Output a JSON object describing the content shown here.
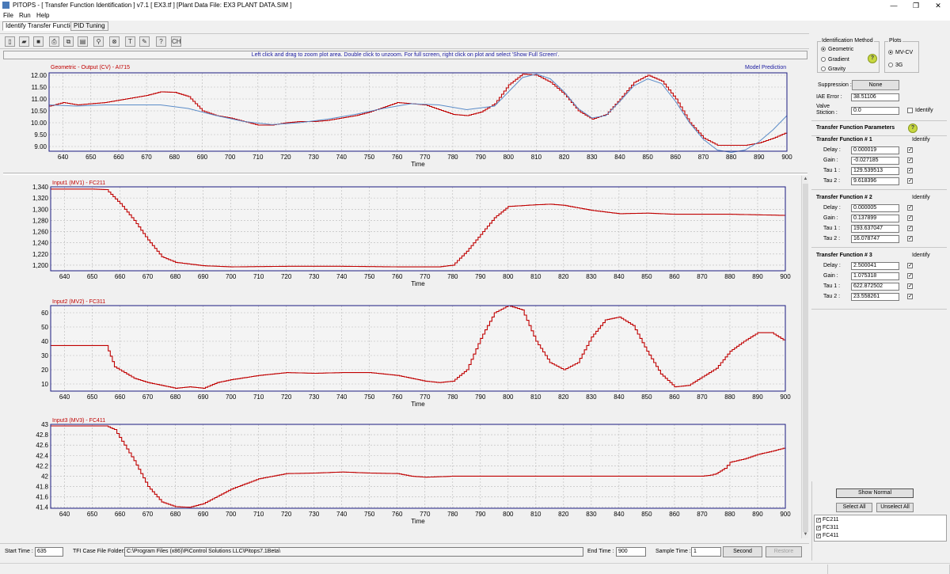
{
  "window": {
    "title": "PITOPS - [ Transfer Function Identification ] v7.1   [ EX3.tf ] [Plant Data File: EX3 PLANT DATA.SIM ]",
    "minimize": "—",
    "restore": "❐",
    "close": "✕"
  },
  "menu": [
    "File",
    "Run",
    "Help"
  ],
  "tabs": [
    "Identify Transfer Functions",
    "PID Tuning"
  ],
  "toolbar": {
    "icons": [
      "new-file-icon",
      "open-folder-icon",
      "save-icon",
      "print-icon",
      "copy-icon",
      "chart-icon",
      "zoom-icon",
      "stop-icon",
      "text-icon",
      "pen-icon",
      "help-icon",
      "ch-icon"
    ],
    "glyphs": [
      "▯",
      "▰",
      "■",
      "⎙",
      "⧉",
      "▤",
      "⚲",
      "⊗",
      "T",
      "✎",
      "?",
      "CH"
    ]
  },
  "hint": "Left click and drag to zoom plot area. Double click to unzoom. For full screen, right click on plot and select 'Show Full Screen'.",
  "charts": [
    {
      "id": "output",
      "title": "Geometric - Output (CV) - AI715",
      "legend_right": "Model Prediction",
      "xlabel": "Time",
      "xticks": [
        640,
        650,
        660,
        670,
        680,
        690,
        700,
        710,
        720,
        730,
        740,
        750,
        760,
        770,
        780,
        790,
        800,
        810,
        820,
        830,
        840,
        850,
        860,
        870,
        880,
        890,
        900
      ],
      "yticks": [
        "12.00",
        "11.50",
        "11.00",
        "10.50",
        "10.00",
        "9.50",
        "9.00"
      ]
    },
    {
      "id": "mv1",
      "title": "Input1 (MV1) - FC211",
      "xlabel": "Time",
      "xticks": [
        640,
        650,
        660,
        670,
        680,
        690,
        700,
        710,
        720,
        730,
        740,
        750,
        760,
        770,
        780,
        790,
        800,
        810,
        820,
        830,
        840,
        850,
        860,
        870,
        880,
        890,
        900
      ],
      "yticks": [
        "1,340",
        "1,320",
        "1,300",
        "1,280",
        "1,260",
        "1,240",
        "1,220",
        "1,200"
      ]
    },
    {
      "id": "mv2",
      "title": "Input2 (MV2) - FC311",
      "xlabel": "Time",
      "xticks": [
        640,
        650,
        660,
        670,
        680,
        690,
        700,
        710,
        720,
        730,
        740,
        750,
        760,
        770,
        780,
        790,
        800,
        810,
        820,
        830,
        840,
        850,
        860,
        870,
        880,
        890,
        900
      ],
      "yticks": [
        "60",
        "50",
        "40",
        "30",
        "20",
        "10"
      ]
    },
    {
      "id": "mv3",
      "title": "Input3 (MV3) - FC411",
      "xlabel": "Time",
      "xticks": [
        640,
        650,
        660,
        670,
        680,
        690,
        700,
        710,
        720,
        730,
        740,
        750,
        760,
        770,
        780,
        790,
        800,
        810,
        820,
        830,
        840,
        850,
        860,
        870,
        880,
        890,
        900
      ],
      "yticks": [
        "43",
        "42.8",
        "42.6",
        "42.4",
        "42.2",
        "42",
        "41.8",
        "41.6",
        "41.4"
      ]
    }
  ],
  "chart_data": [
    {
      "type": "line",
      "title": "Geometric - Output (CV) - AI715",
      "xlabel": "Time",
      "xlim": [
        635,
        900
      ],
      "ylim": [
        8.8,
        12.1
      ],
      "grid": true,
      "series": [
        {
          "name": "",
          "color": "#c00000",
          "x": [
            635,
            640,
            645,
            650,
            655,
            660,
            665,
            670,
            675,
            680,
            685,
            690,
            695,
            700,
            705,
            710,
            715,
            720,
            725,
            730,
            735,
            740,
            745,
            750,
            755,
            760,
            765,
            770,
            775,
            780,
            785,
            790,
            795,
            800,
            805,
            810,
            815,
            820,
            825,
            830,
            835,
            840,
            845,
            850,
            855,
            860,
            865,
            870,
            875,
            880,
            885,
            890,
            895,
            900
          ],
          "y": [
            10.7,
            10.85,
            10.75,
            10.8,
            10.85,
            10.95,
            11.05,
            11.15,
            11.3,
            11.28,
            11.1,
            10.5,
            10.3,
            10.2,
            10.05,
            9.9,
            9.9,
            10.0,
            10.05,
            10.05,
            10.1,
            10.2,
            10.3,
            10.45,
            10.65,
            10.85,
            10.8,
            10.75,
            10.55,
            10.35,
            10.3,
            10.45,
            10.8,
            11.6,
            12.05,
            12.0,
            11.7,
            11.2,
            10.5,
            10.15,
            10.35,
            11.0,
            11.7,
            12.0,
            11.75,
            11.0,
            10.0,
            9.35,
            9.05,
            9.05,
            9.05,
            9.15,
            9.35,
            9.6
          ]
        },
        {
          "name": "Model Prediction",
          "color": "#5b8cc8",
          "x": [
            635,
            645,
            655,
            665,
            675,
            685,
            695,
            705,
            715,
            725,
            735,
            745,
            755,
            765,
            775,
            785,
            795,
            800,
            805,
            810,
            815,
            820,
            825,
            830,
            835,
            840,
            845,
            850,
            855,
            860,
            865,
            870,
            875,
            880,
            885,
            890,
            895,
            900
          ],
          "y": [
            10.75,
            10.7,
            10.75,
            10.75,
            10.75,
            10.6,
            10.3,
            10.05,
            9.92,
            10.0,
            10.15,
            10.35,
            10.6,
            10.8,
            10.75,
            10.55,
            10.7,
            11.3,
            11.9,
            12.05,
            11.85,
            11.3,
            10.6,
            10.2,
            10.3,
            10.9,
            11.55,
            11.85,
            11.65,
            10.9,
            10.0,
            9.3,
            8.85,
            8.75,
            8.85,
            9.2,
            9.7,
            10.3
          ]
        }
      ]
    },
    {
      "type": "line",
      "title": "Input1 (MV1) - FC211",
      "xlabel": "Time",
      "xlim": [
        635,
        900
      ],
      "ylim": [
        1190,
        1340
      ],
      "grid": true,
      "series": [
        {
          "name": "",
          "color": "#c00000",
          "x": [
            635,
            650,
            655,
            660,
            665,
            670,
            675,
            680,
            690,
            700,
            720,
            740,
            760,
            775,
            780,
            785,
            790,
            795,
            800,
            810,
            815,
            820,
            830,
            840,
            850,
            860,
            870,
            880,
            890,
            900
          ],
          "y": [
            1336,
            1336,
            1335,
            1310,
            1280,
            1245,
            1215,
            1205,
            1199,
            1197,
            1198,
            1198,
            1197,
            1197,
            1200,
            1225,
            1255,
            1285,
            1305,
            1308,
            1309,
            1307,
            1298,
            1292,
            1293,
            1291,
            1291,
            1291,
            1290,
            1289
          ]
        }
      ]
    },
    {
      "type": "line",
      "title": "Input2 (MV2) - FC311",
      "xlabel": "Time",
      "xlim": [
        635,
        900
      ],
      "ylim": [
        5,
        65
      ],
      "grid": true,
      "series": [
        {
          "name": "",
          "color": "#c00000",
          "x": [
            635,
            650,
            655,
            658,
            665,
            670,
            675,
            680,
            685,
            690,
            695,
            700,
            710,
            720,
            730,
            740,
            750,
            760,
            770,
            775,
            780,
            785,
            790,
            795,
            800,
            805,
            810,
            815,
            820,
            825,
            830,
            835,
            840,
            845,
            850,
            855,
            860,
            865,
            870,
            875,
            880,
            885,
            890,
            895,
            900
          ],
          "y": [
            37,
            37,
            37,
            22,
            14,
            11,
            9,
            7,
            8,
            7,
            11,
            13,
            16,
            18,
            17.5,
            18,
            18,
            16,
            12,
            11,
            12,
            20,
            42,
            60,
            65,
            62,
            40,
            25,
            20,
            25,
            43,
            55,
            57,
            51,
            33,
            17,
            8,
            9,
            15,
            21,
            33,
            40,
            46,
            46,
            40
          ]
        }
      ]
    },
    {
      "type": "line",
      "title": "Input3 (MV3) - FC411",
      "xlabel": "Time",
      "xlim": [
        635,
        900
      ],
      "ylim": [
        41.38,
        43.0
      ],
      "grid": true,
      "series": [
        {
          "name": "",
          "color": "#c00000",
          "x": [
            635,
            655,
            658,
            665,
            670,
            675,
            680,
            685,
            690,
            700,
            710,
            720,
            730,
            740,
            750,
            760,
            765,
            770,
            780,
            800,
            820,
            860,
            870,
            873,
            875,
            878,
            880,
            885,
            890,
            895,
            900
          ],
          "y": [
            42.97,
            42.97,
            42.9,
            42.3,
            41.8,
            41.5,
            41.41,
            41.4,
            41.47,
            41.75,
            41.95,
            42.05,
            42.06,
            42.08,
            42.06,
            42.05,
            42.0,
            41.98,
            42.0,
            42.0,
            42.0,
            42.0,
            42.0,
            42.02,
            42.05,
            42.15,
            42.27,
            42.33,
            42.42,
            42.48,
            42.55
          ]
        }
      ]
    }
  ],
  "right_panel": {
    "ident_method_label": "Identification Method",
    "methods": [
      "Geometric",
      "Gradient",
      "Gravity"
    ],
    "method_selected": "Geometric",
    "plots_label": "Plots",
    "plot_options": [
      "MV-CV",
      "3G"
    ],
    "plot_selected": "MV-CV",
    "suppression_label": "Suppression :",
    "suppression_value": "None",
    "iae_label": "IAE Error :",
    "iae_value": "38.51106",
    "valve_label_1": "Valve",
    "valve_label_2": "Stiction :",
    "valve_value": "0.0",
    "identify_label": "Identify",
    "tfp_title": "Transfer Function Parameters",
    "help_glyph": "?",
    "tf_blocks": [
      {
        "title": "Transfer Function # 1",
        "identify": "Identify",
        "params": [
          {
            "label": "Delay :",
            "value": "0.000019"
          },
          {
            "label": "Gain :",
            "value": "-0.027185"
          },
          {
            "label": "Tau 1 :",
            "value": "129.539513"
          },
          {
            "label": "Tau 2 :",
            "value": "9.618396"
          }
        ]
      },
      {
        "title": "Transfer Function # 2",
        "identify": "Identify",
        "params": [
          {
            "label": "Delay :",
            "value": "0.000005"
          },
          {
            "label": "Gain :",
            "value": "0.137899"
          },
          {
            "label": "Tau 1 :",
            "value": "193.637047"
          },
          {
            "label": "Tau 2 :",
            "value": "16.078747"
          }
        ]
      },
      {
        "title": "Transfer Function # 3",
        "identify": "Identify",
        "params": [
          {
            "label": "Delay :",
            "value": "2.500041"
          },
          {
            "label": "Gain :",
            "value": "1.075318"
          },
          {
            "label": "Tau 1 :",
            "value": "622.872502"
          },
          {
            "label": "Tau 2 :",
            "value": "23.558261"
          }
        ]
      }
    ],
    "check_glyph": "✓",
    "show_normal": "Show Normal",
    "select_all": "Select All",
    "unselect_all": "Unselect All",
    "tags": [
      "FC211",
      "FC311",
      "FC411"
    ]
  },
  "bottom": {
    "start_time_label": "Start Time :",
    "start_time_value": "635",
    "folder_label": "TFI Case File Folder:",
    "folder_value": "C:\\Program Files (x86)\\PiControl Solutions LLC\\Pitops7.1Beta\\",
    "end_time_label": "End Time :",
    "end_time_value": "900",
    "sample_time_label": "Sample Time :",
    "sample_time_value": "1",
    "unit_button": "Second",
    "restore_button": "Restore"
  },
  "colors": {
    "cv": "#c00000",
    "model": "#5b8cc8",
    "axis": "#1a1a80",
    "grid": "#b8b8b8"
  }
}
